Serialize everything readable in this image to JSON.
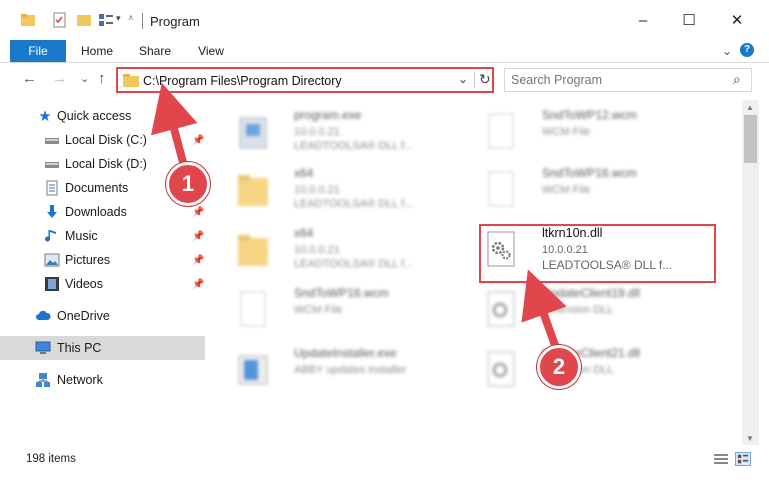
{
  "window": {
    "title": "Program",
    "minimize_glyph": "–",
    "maximize_glyph": "☐",
    "close_glyph": "✕"
  },
  "ribbon": {
    "tabs": [
      "File",
      "Home",
      "Share",
      "View"
    ],
    "help_glyph": "?",
    "expand_glyph": "⌄"
  },
  "address": {
    "back_glyph": "←",
    "forward_glyph": "→",
    "recent_glyph": "⌄",
    "up_glyph": "↑",
    "path": "C:\\Program Files\\Program Directory",
    "dropdown_glyph": "⌄",
    "refresh_glyph": "↻",
    "search_placeholder": "Search Program",
    "search_glyph": "⌕"
  },
  "nav": {
    "items": [
      {
        "label": "Quick access",
        "icon": "star-icon",
        "pinned": false
      },
      {
        "label": "Local Disk (C:)",
        "icon": "drive-icon",
        "pinned": true
      },
      {
        "label": "Local Disk (D:)",
        "icon": "drive-icon",
        "pinned": true
      },
      {
        "label": "Documents",
        "icon": "documents-icon",
        "pinned": false
      },
      {
        "label": "Downloads",
        "icon": "download-icon",
        "pinned": true
      },
      {
        "label": "Music",
        "icon": "music-icon",
        "pinned": true
      },
      {
        "label": "Pictures",
        "icon": "pictures-icon",
        "pinned": true
      },
      {
        "label": "Videos",
        "icon": "videos-icon",
        "pinned": true
      },
      {
        "label": "OneDrive",
        "icon": "cloud-icon",
        "pinned": false
      },
      {
        "label": "This PC",
        "icon": "computer-icon",
        "pinned": false,
        "selected": true
      },
      {
        "label": "Network",
        "icon": "network-icon",
        "pinned": false
      }
    ],
    "pin_glyph": "📌"
  },
  "files": {
    "left": [
      {
        "name": "program.exe",
        "l2": "10.0.0.21",
        "l3": "LEADTOOLSA® DLL f..."
      },
      {
        "name": "x64",
        "l2": "10.0.0.21",
        "l3": "LEADTOOLSA® DLL f..."
      },
      {
        "name": "x64",
        "l2": "10.0.0.21",
        "l3": "LEADTOOLSA® DLL f..."
      },
      {
        "name": "SndToWP16.wcm",
        "l2": "WCM File",
        "l3": ""
      },
      {
        "name": "UpdateInstaller.exe",
        "l2": "ABBY updates installer",
        "l3": ""
      }
    ],
    "right": [
      {
        "name": "SndToWP12.wcm",
        "l2": "WCM File",
        "l3": ""
      },
      {
        "name": "SndToWP16.wcm",
        "l2": "WCM File",
        "l3": ""
      },
      {
        "name": "ltkrn10n.dll",
        "l2": "10.0.0.21",
        "l3": "LEADTOOLSA® DLL f...",
        "highlight": true
      },
      {
        "name": "UpdateClient19.dll",
        "l2": "Extension DLL",
        "l3": ""
      },
      {
        "name": "UpdateClient21.dll",
        "l2": "Extension DLL",
        "l3": ""
      }
    ]
  },
  "status": {
    "item_count": "198 items"
  },
  "callouts": [
    "1",
    "2"
  ],
  "colors": {
    "accent": "#1979ca",
    "highlight": "#e0474c",
    "folder": "#f2c75c"
  }
}
